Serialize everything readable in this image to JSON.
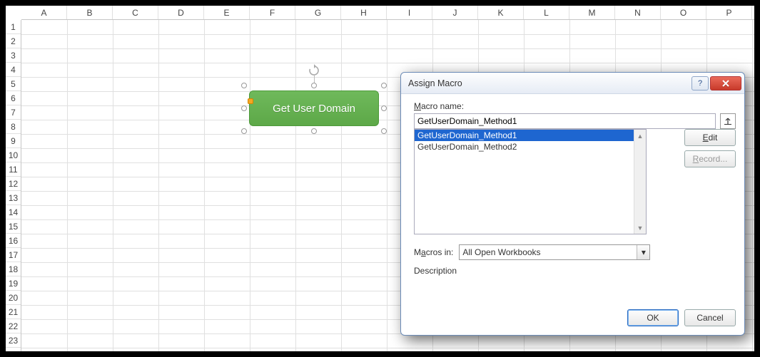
{
  "grid": {
    "cols": [
      "A",
      "B",
      "C",
      "D",
      "E",
      "F",
      "G",
      "H",
      "I",
      "J",
      "K",
      "L",
      "M",
      "N",
      "O",
      "P"
    ],
    "rows": [
      "1",
      "2",
      "3",
      "4",
      "5",
      "6",
      "7",
      "8",
      "9",
      "10",
      "11",
      "12",
      "13",
      "14",
      "15",
      "16",
      "17",
      "18",
      "19",
      "20",
      "21",
      "22",
      "23"
    ]
  },
  "sheet": {
    "shape_label": "Get User Domain"
  },
  "dialog": {
    "title": "Assign Macro",
    "macro_name_mnemonic": "M",
    "macro_name_rest": "acro name:",
    "macro_name_value": "GetUserDomain_Method1",
    "list": [
      "GetUserDomain_Method1",
      "GetUserDomain_Method2"
    ],
    "edit_mnemonic": "E",
    "edit_rest": "dit",
    "record_mnemonic": "R",
    "record_rest": "ecord...",
    "macros_in_pre": "M",
    "macros_in_mnemonic": "a",
    "macros_in_post": "cros in:",
    "macros_in_value": "All Open Workbooks",
    "description_label": "Description",
    "ok": "OK",
    "cancel": "Cancel"
  }
}
